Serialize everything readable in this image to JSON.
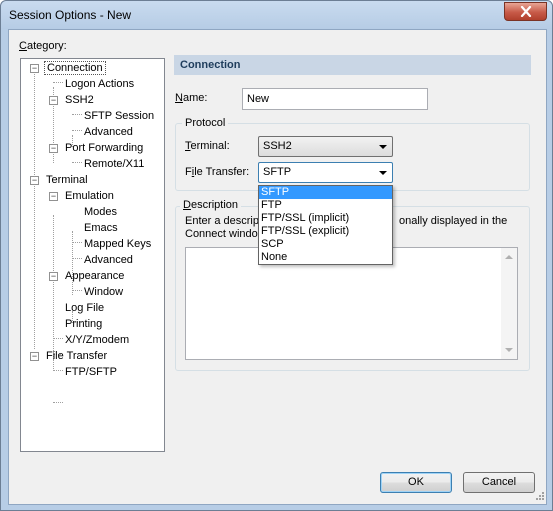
{
  "window": {
    "title": "Session Options - New"
  },
  "category": {
    "label": "Category:",
    "tree": [
      {
        "label": "Connection"
      },
      {
        "label": "Logon Actions"
      },
      {
        "label": "SSH2"
      },
      {
        "label": "SFTP Session"
      },
      {
        "label": "Advanced"
      },
      {
        "label": "Port Forwarding"
      },
      {
        "label": "Remote/X11"
      },
      {
        "label": "Terminal"
      },
      {
        "label": "Emulation"
      },
      {
        "label": "Modes"
      },
      {
        "label": "Emacs"
      },
      {
        "label": "Mapped Keys"
      },
      {
        "label": "Advanced"
      },
      {
        "label": "Appearance"
      },
      {
        "label": "Window"
      },
      {
        "label": "Log File"
      },
      {
        "label": "Printing"
      },
      {
        "label": "X/Y/Zmodem"
      },
      {
        "label": "File Transfer"
      },
      {
        "label": "FTP/SFTP"
      }
    ]
  },
  "panel": {
    "header": "Connection",
    "name": {
      "label_u": "N",
      "label_rest": "ame:",
      "value": "New"
    },
    "protocol": {
      "title": "Protocol",
      "terminal": {
        "label_u": "T",
        "label_rest": "erminal:",
        "value": "SSH2"
      },
      "file_transfer": {
        "label_pre": "F",
        "label_u": "i",
        "label_rest": "le Transfer:",
        "value": "SFTP"
      },
      "file_transfer_options": [
        "SFTP",
        "FTP",
        "FTP/SSL (implicit)",
        "FTP/SSL (explicit)",
        "SCP",
        "None"
      ]
    },
    "description": {
      "title_u": "D",
      "title_rest": "escription",
      "hint_line1_start": "Enter a descrip",
      "hint_line1_end": "onally displayed in the",
      "hint_line2_start": "Connect windo"
    }
  },
  "buttons": {
    "ok": "OK",
    "cancel": "Cancel"
  },
  "colors": {
    "selection": "#3399ff",
    "header_bg": "#c9d6e5",
    "close": "#c75a48"
  }
}
